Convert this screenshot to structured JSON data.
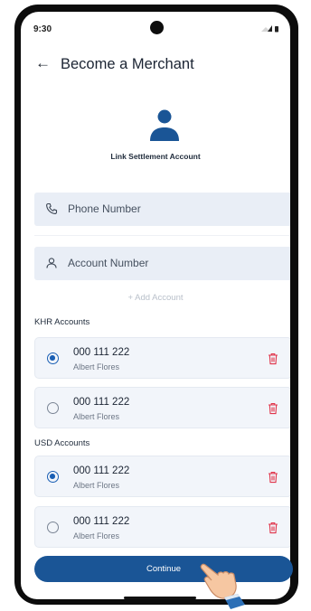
{
  "status": {
    "time": "9:30"
  },
  "header": {
    "back_icon": "arrow-left-icon",
    "title": "Become a Merchant"
  },
  "section": {
    "icon": "user-icon",
    "title": "Link Settlement Account"
  },
  "form": {
    "phone_placeholder": "Phone Number",
    "account_placeholder": "Account Number",
    "add_account": "+ Add Account"
  },
  "groups": {
    "khr": {
      "label": "KHR Accounts",
      "items": [
        {
          "number": "000 111 222",
          "name": "Albert Flores",
          "selected": true
        },
        {
          "number": "000 111 222",
          "name": "Albert Flores",
          "selected": false
        }
      ]
    },
    "usd": {
      "label": "USD Accounts",
      "items": [
        {
          "number": "000 111 222",
          "name": "Albert Flores",
          "selected": true
        },
        {
          "number": "000 111 222",
          "name": "Albert Flores",
          "selected": false
        }
      ]
    }
  },
  "footer": {
    "continue_label": "Continue"
  },
  "colors": {
    "primary": "#1a5596",
    "accent": "#1a5fb4",
    "danger": "#e0344a",
    "field_bg": "#e9eef6"
  }
}
